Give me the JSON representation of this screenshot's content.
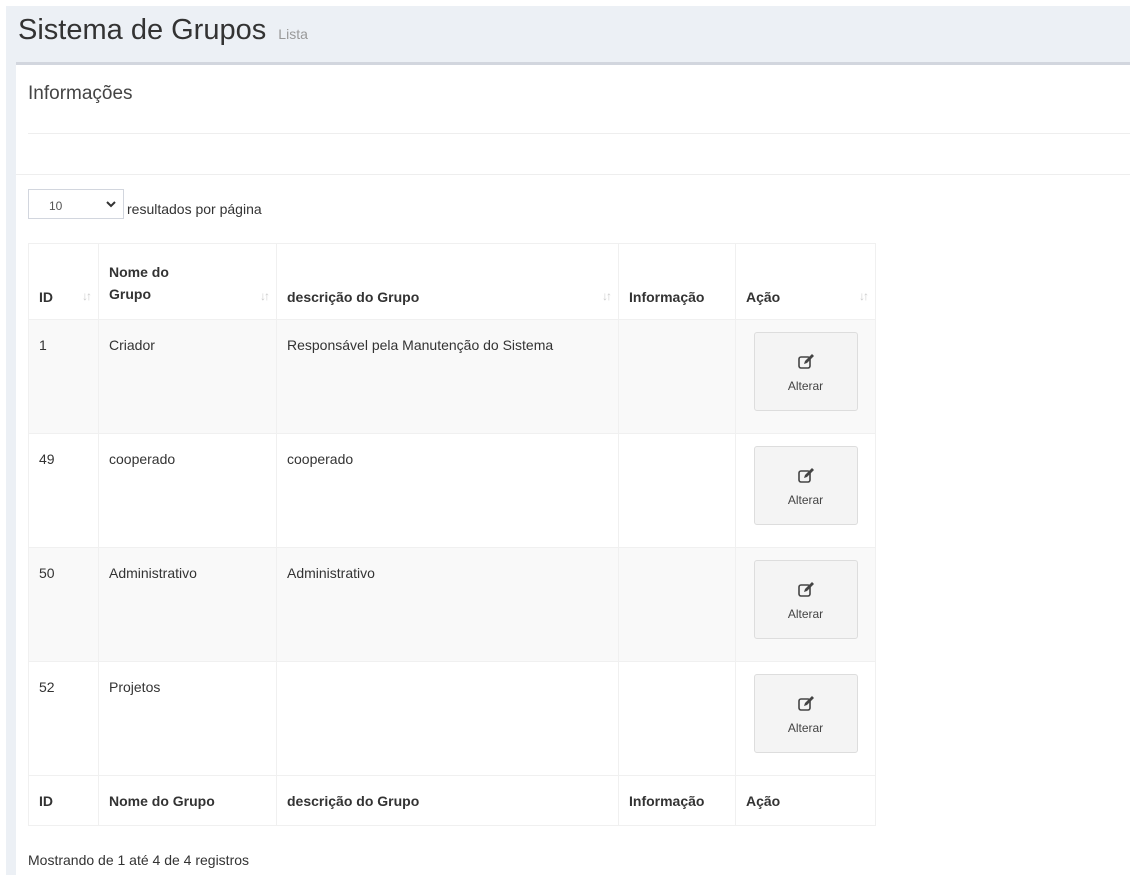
{
  "header": {
    "title": "Sistema de Grupos",
    "subtitle": "Lista"
  },
  "box": {
    "title": "Informações"
  },
  "length": {
    "value": "10",
    "label": "resultados por página"
  },
  "table": {
    "head": [
      "ID",
      "Nome do Grupo",
      "descrição do Grupo",
      "Informação",
      "Ação"
    ],
    "rows": [
      {
        "id": "1",
        "name": "Criador",
        "desc": "Responsável pela Manutenção do Sistema",
        "info": "",
        "action": "Alterar"
      },
      {
        "id": "49",
        "name": "cooperado",
        "desc": "cooperado",
        "info": "",
        "action": "Alterar"
      },
      {
        "id": "50",
        "name": "Administrativo",
        "desc": "Administrativo",
        "info": "",
        "action": "Alterar"
      },
      {
        "id": "52",
        "name": "Projetos",
        "desc": "",
        "info": "",
        "action": "Alterar"
      }
    ],
    "foot": [
      "ID",
      "Nome do Grupo",
      "descrição do Grupo",
      "Informação",
      "Ação"
    ]
  },
  "info": "Mostrando de 1 até 4 de 4 registros"
}
